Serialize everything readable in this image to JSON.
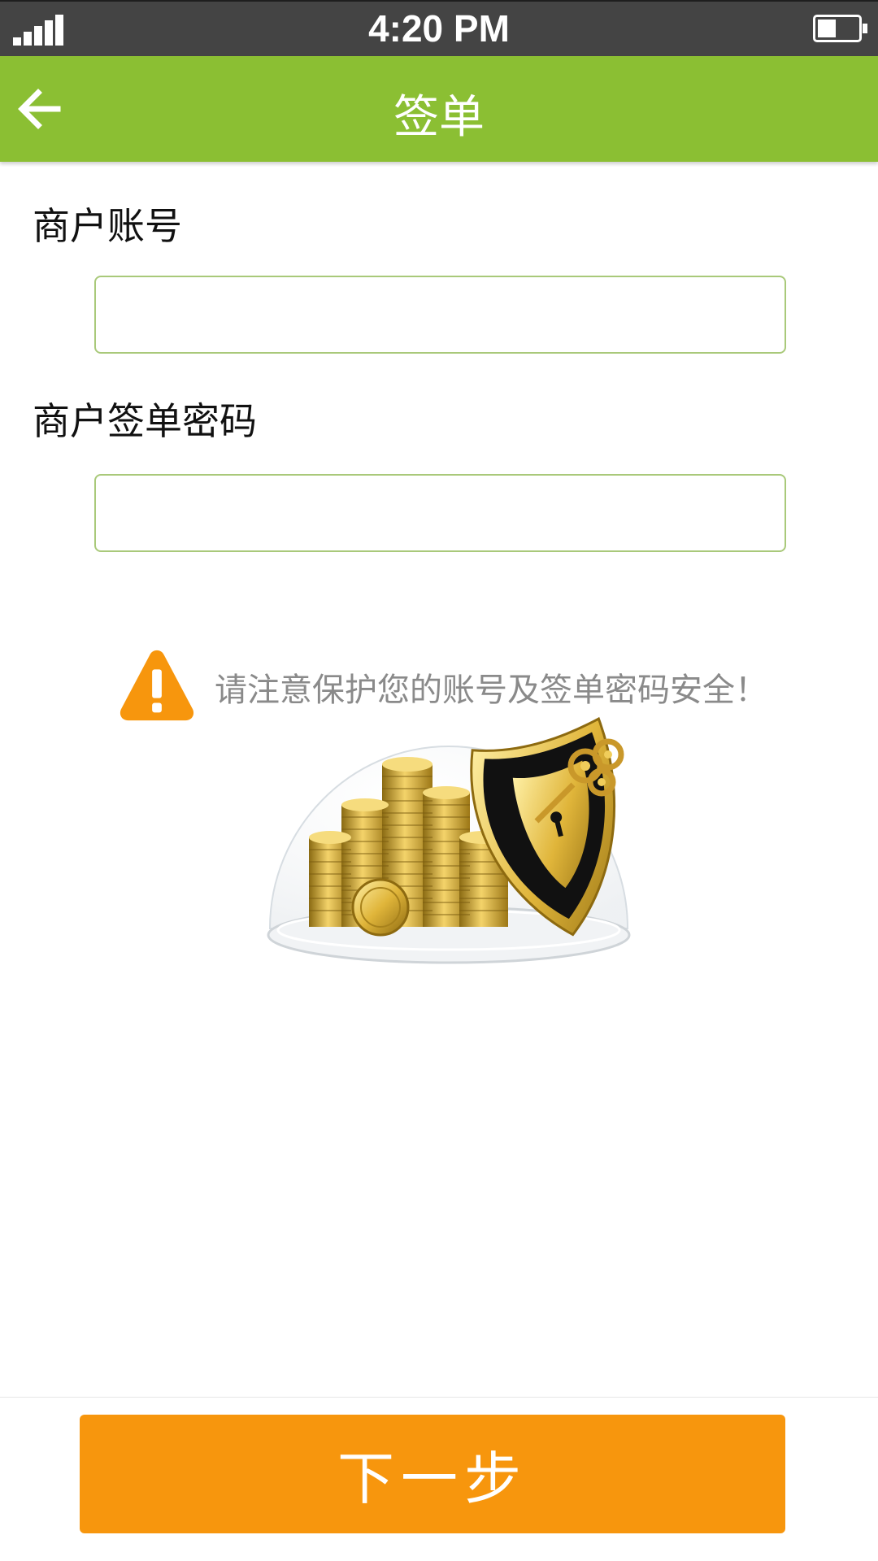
{
  "status_bar": {
    "time": "4:20 PM",
    "signal_icon": "signal-bars-icon",
    "battery_icon": "battery-icon",
    "battery_level": 0.45
  },
  "header": {
    "back_icon": "arrow-left-icon",
    "title": "签单"
  },
  "form": {
    "account_label": "商户账号",
    "account_value": "",
    "password_label": "商户签单密码",
    "password_value": ""
  },
  "warning": {
    "icon": "warning-triangle-icon",
    "text": "请注意保护您的账号及签单密码安全！"
  },
  "illustration": {
    "icon": "coins-shield-key-illustration"
  },
  "footer": {
    "next_label": "下一步"
  },
  "colors": {
    "status_bar": "#444444",
    "header": "#8bbf33",
    "input_border": "#a9c97a",
    "warning": "#f7960d",
    "next_button": "#f7960d"
  }
}
